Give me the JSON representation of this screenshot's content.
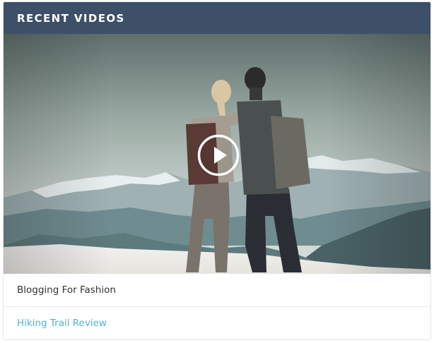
{
  "widget": {
    "title": "RECENT VIDEOS",
    "header_color": "#3e5068",
    "link_color": "#4fb3d4",
    "play_icon": "play-circle-icon",
    "videos": [
      {
        "title": "Blogging For Fashion",
        "state": "current"
      },
      {
        "title": "Hiking Trail Review",
        "state": "link"
      }
    ]
  }
}
